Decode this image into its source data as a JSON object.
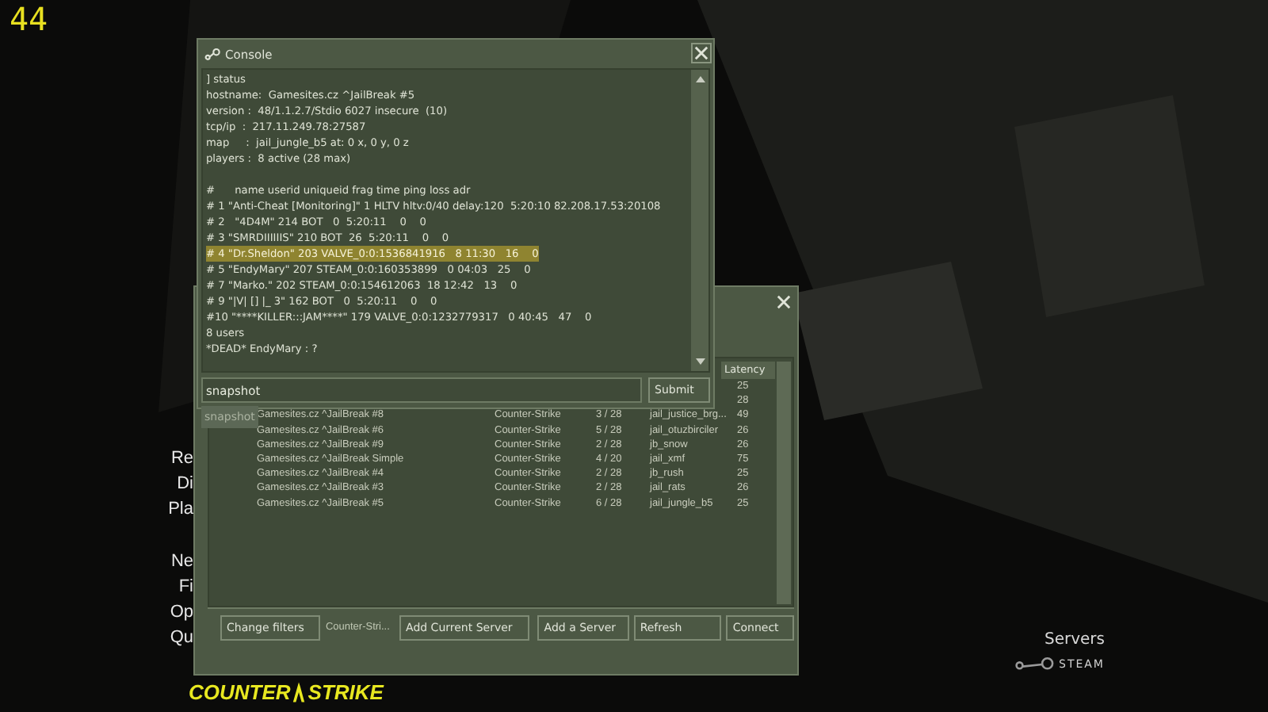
{
  "fps": "44",
  "main_menu": {
    "items": [
      {
        "label": "Re"
      },
      {
        "label": "Di"
      },
      {
        "label": "Pla"
      },
      {
        "label": "Ne"
      },
      {
        "label": "Fi"
      },
      {
        "label": "Op"
      },
      {
        "label": "Qu"
      }
    ]
  },
  "logo": {
    "left": "COUNTER",
    "right": "STRIKE"
  },
  "steam": {
    "label": "Servers",
    "brand": "STEAM"
  },
  "server_browser": {
    "columns": [
      "Latency"
    ],
    "rows": [
      {
        "name": "",
        "game": "",
        "players": "",
        "map": "",
        "latency": "25"
      },
      {
        "name": "",
        "game": "",
        "players": "",
        "map": "",
        "latency": "28"
      },
      {
        "name": "Gamesites.cz ^JailBreak #8",
        "game": "Counter-Strike",
        "players": "3 / 28",
        "map": "jail_justice_brg...",
        "latency": "49"
      },
      {
        "name": "Gamesites.cz ^JailBreak #6",
        "game": "Counter-Strike",
        "players": "5 / 28",
        "map": "jail_otuzbirciler",
        "latency": "26"
      },
      {
        "name": "Gamesites.cz ^JailBreak #9",
        "game": "Counter-Strike",
        "players": "2 / 28",
        "map": "jb_snow",
        "latency": "26"
      },
      {
        "name": "Gamesites.cz ^JailBreak Simple",
        "game": "Counter-Strike",
        "players": "4 / 20",
        "map": "jail_xmf",
        "latency": "75"
      },
      {
        "name": "Gamesites.cz ^JailBreak #4",
        "game": "Counter-Strike",
        "players": "2 / 28",
        "map": "jb_rush",
        "latency": "25"
      },
      {
        "name": "Gamesites.cz ^JailBreak #3",
        "game": "Counter-Strike",
        "players": "2 / 28",
        "map": "jail_rats",
        "latency": "26"
      },
      {
        "name": "Gamesites.cz ^JailBreak #5",
        "game": "Counter-Strike",
        "players": "6 / 28",
        "map": "jail_jungle_b5",
        "latency": "25"
      }
    ],
    "filter_button": "Change filters",
    "filter_text": "Counter-Stri...",
    "buttons": [
      "Add Current Server",
      "Add a Server",
      "Refresh",
      "Connect"
    ]
  },
  "console": {
    "title": "Console",
    "status_lines": [
      {
        "text": "] status",
        "selected": false
      },
      {
        "text": "hostname:  Gamesites.cz ^JailBreak #5",
        "selected": false
      },
      {
        "text": "version :  48/1.1.2.7/Stdio 6027 insecure  (10)",
        "selected": false
      },
      {
        "text": "tcp/ip  :  217.11.249.78:27587",
        "selected": false
      },
      {
        "text": "map     :  jail_jungle_b5 at: 0 x, 0 y, 0 z",
        "selected": false
      },
      {
        "text": "players :  8 active (28 max)",
        "selected": false
      }
    ],
    "player_lines": [
      {
        "text": "#      name userid uniqueid frag time ping loss adr",
        "selected": false
      },
      {
        "text": "# 1 \"Anti-Cheat [Monitoring]\" 1 HLTV hltv:0/40 delay:120  5:20:10 82.208.17.53:20108",
        "selected": false
      },
      {
        "text": "# 2   \"4D4M\" 214 BOT   0  5:20:11    0    0",
        "selected": false
      },
      {
        "text": "# 3 \"SMRDIIIIIIS\" 210 BOT  26  5:20:11    0    0",
        "selected": false
      },
      {
        "text": "# 4 \"Dr.Sheldon\" 203 VALVE_0:0:1536841916   8 11:30   16    0",
        "selected": true
      },
      {
        "text": "# 5 \"EndyMary\" 207 STEAM_0:0:160353899   0 04:03   25    0",
        "selected": false
      },
      {
        "text": "# 7 \"Marko.\" 202 STEAM_0:0:154612063  18 12:42   13    0",
        "selected": false
      },
      {
        "text": "# 9 \"|V| [] |_ 3\" 162 BOT   0  5:20:11    0    0",
        "selected": false
      },
      {
        "text": "#10 \"****KILLER:::JAM****\" 179 VALVE_0:0:1232779317   0 40:45   47    0",
        "selected": false
      },
      {
        "text": "8 users",
        "selected": false
      },
      {
        "text": "*DEAD* EndyMary : ?",
        "selected": false
      }
    ],
    "input_value": "snapshot",
    "submit": "Submit",
    "tooltip": "snapshot"
  }
}
